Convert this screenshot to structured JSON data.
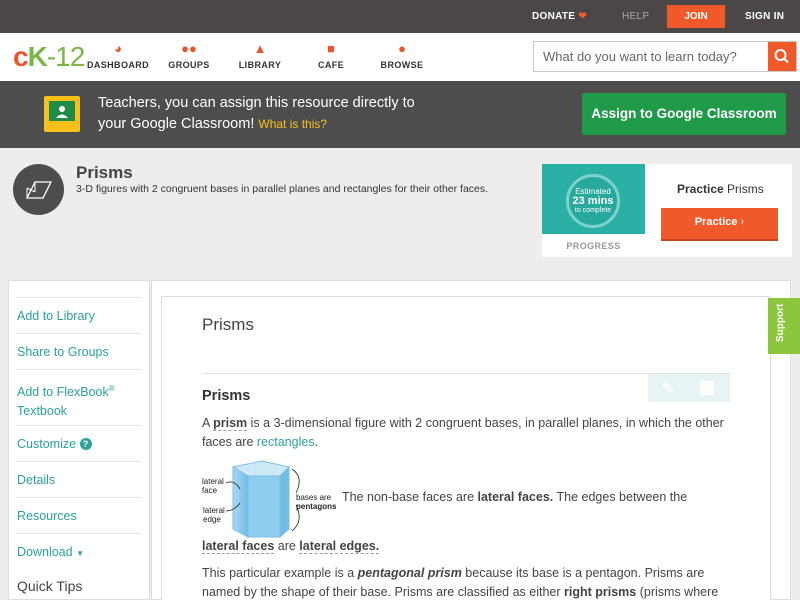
{
  "topbar": {
    "donate": "DONATE",
    "help": "HELP",
    "join": "JOIN",
    "signin": "SIGN IN"
  },
  "nav": {
    "logo_c": "c",
    "logo_k": "K",
    "logo_num": "-12",
    "items": [
      {
        "label": "DASHBOARD",
        "icon": "dashboard-icon"
      },
      {
        "label": "GROUPS",
        "icon": "groups-icon"
      },
      {
        "label": "LIBRARY",
        "icon": "library-icon"
      },
      {
        "label": "CAFE",
        "icon": "cafe-icon"
      },
      {
        "label": "BROWSE",
        "icon": "browse-icon"
      }
    ],
    "search_placeholder": "What do you want to learn today?"
  },
  "banner": {
    "line1": "Teachers, you can assign this resource directly to",
    "line2": "your Google Classroom!",
    "what_is_this": "What is this?",
    "button": "Assign to Google Classroom"
  },
  "concept": {
    "title": "Prisms",
    "description": "3-D figures with 2 congruent bases in parallel planes and rectangles for their other faces."
  },
  "practice_card": {
    "estimated": "Estimated",
    "mins": "23 mins",
    "to_complete": "to complete",
    "progress": "PROGRESS",
    "title_bold": "Practice",
    "title_rest": "Prisms",
    "button": "Practice"
  },
  "sidebar": {
    "add_library": "Add to Library",
    "share_groups": "Share to Groups",
    "add_flexbook_1": "Add to FlexBook",
    "add_flexbook_sup": "®",
    "add_flexbook_2": "Textbook",
    "customize": "Customize",
    "details": "Details",
    "resources": "Resources",
    "download": "Download",
    "quick_tips": "Quick Tips"
  },
  "article": {
    "title": "Prisms",
    "section_title": "Prisms",
    "p1_a": "A ",
    "p1_prism": "prism",
    "p1_b": " is a 3-dimensional figure with 2 congruent bases, in parallel planes, in which the other faces are ",
    "p1_rect": "rectangles",
    "p1_c": ".",
    "fig_lateral_face_1": "lateral",
    "fig_lateral_face_2": "face",
    "fig_lateral_edge_1": "lateral",
    "fig_lateral_edge_2": "edge",
    "fig_bases_1": "bases are",
    "fig_bases_2": "pentagons",
    "p2_a": "The non-base faces are ",
    "p2_lf": "lateral faces.",
    "p2_b": " The edges between the",
    "p2_c_term1": "lateral faces",
    "p2_c_mid": " are ",
    "p2_c_term2": "lateral edges.",
    "p3_a": "This particular example is a ",
    "p3_pp": "pentagonal prism",
    "p3_b": " because its base is a pentagon. Prisms are named by the shape of their base. Prisms are classified as either ",
    "p3_rp": "right prisms",
    "p3_c": " (prisms where all"
  },
  "support": "Support",
  "colors": {
    "accent_orange": "#f0592a",
    "brand_green": "#7ab548",
    "teal": "#2ca09b",
    "assign_green": "#1f9a48"
  }
}
